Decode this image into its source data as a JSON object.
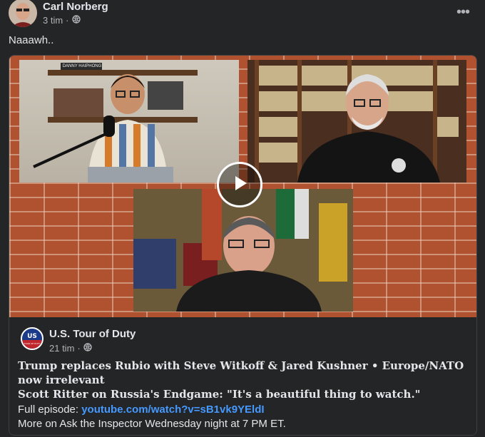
{
  "post": {
    "author": "Carl Norberg",
    "time": "3 tim",
    "privacy_icon": "globe-icon",
    "more_icon": "more-icon",
    "text": "Naaawh.."
  },
  "shared": {
    "video": {
      "play_icon": "play-icon",
      "nameplate": "DANNY HAIPHONG"
    },
    "page_name": "U.S. Tour of Duty",
    "logo_text": {
      "top": "US",
      "bottom": "TOUR OF DUTY"
    },
    "time": "21 tim",
    "headline": "Trump replaces Rubio with Steve Witkoff & Jared Kushner • Europe/NATO now irrelevant",
    "subheadline_bold": "Scott Ritter on Russia's Endgame",
    "subheadline_rest": ": \"It's a beautiful thing to watch.\"",
    "episode_label": "Full episode: ",
    "episode_link": "youtube.com/watch?v=sB1vk9YEldI",
    "more_text": "More on Ask the Inspector Wednesday night at 7 PM ET."
  },
  "colors": {
    "background": "#242526",
    "text": "#e4e6eb",
    "secondary_text": "#b0b3b8",
    "link": "#4599ff",
    "brick": "#b0522f"
  }
}
